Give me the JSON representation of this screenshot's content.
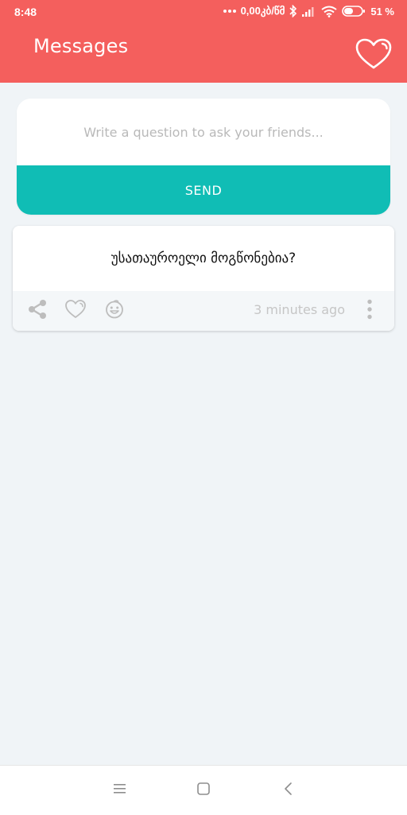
{
  "status_bar": {
    "time": "8:48",
    "speed": "0,00კბ/წმ",
    "battery": "51 %"
  },
  "app_bar": {
    "title": "Messages"
  },
  "composer": {
    "placeholder": "Write a question to ask your friends...",
    "value": "",
    "send_label": "SEND"
  },
  "messages": [
    {
      "text": "უსათაუროელი მოგწონებია?",
      "time": "3 minutes ago"
    }
  ],
  "colors": {
    "header": "#f45f5d",
    "accent": "#10bdb5",
    "background": "#f0f4f7"
  },
  "icons": {
    "favorites": "heart-outline-icon",
    "share": "share-icon",
    "like": "heart-icon",
    "react": "emoji-icon",
    "more": "more-vertical-icon"
  }
}
